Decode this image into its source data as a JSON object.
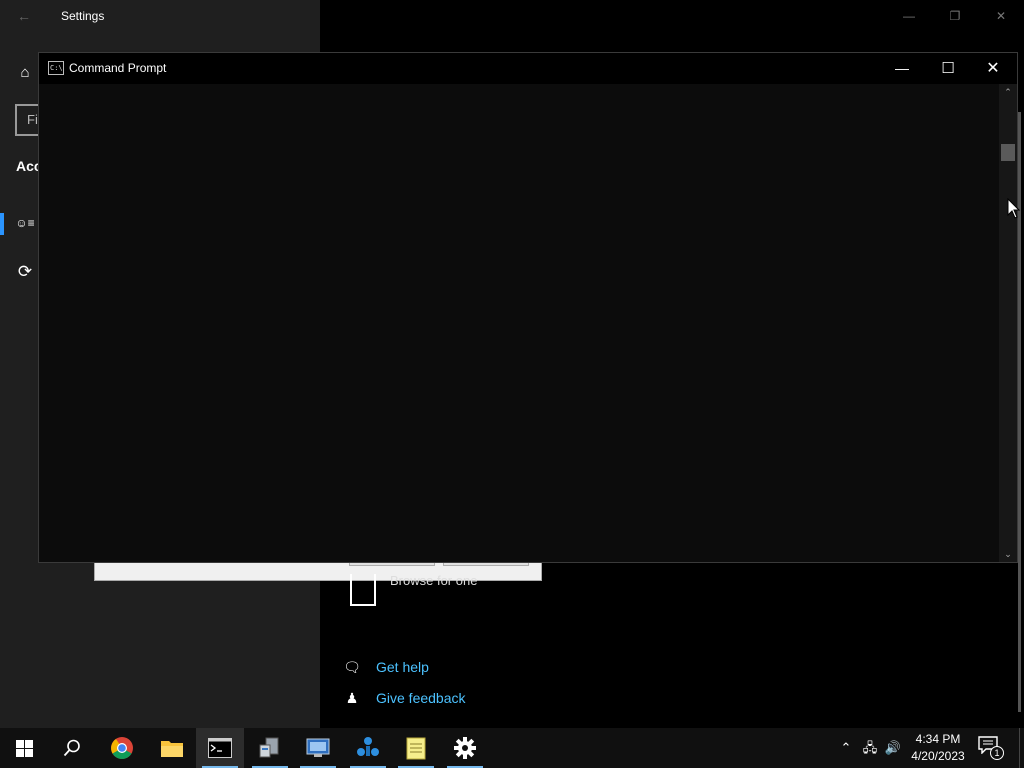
{
  "settings": {
    "title": "Settings",
    "search_placeholder": "Fi",
    "nav_heading": "Acc",
    "browse_text": "Browse for one",
    "help_links": [
      "Get help",
      "Give feedback"
    ]
  },
  "cmd": {
    "title": "Command Prompt",
    "icon_text": "C:\\",
    "console_text": ""
  },
  "taskbar": {
    "apps": [
      {
        "name": "start-button",
        "icon": "windows-logo-icon",
        "active": false
      },
      {
        "name": "search-button",
        "icon": "search-icon",
        "active": false
      },
      {
        "name": "chrome-taskbar-button",
        "icon": "chrome-icon",
        "active": false
      },
      {
        "name": "file-explorer-taskbar-button",
        "icon": "folder-icon",
        "active": false
      },
      {
        "name": "command-prompt-taskbar-button",
        "icon": "command-prompt-icon",
        "active": true
      },
      {
        "name": "app-taskbar-button-1",
        "icon": "server-manager-icon",
        "active": false
      },
      {
        "name": "app-taskbar-button-2",
        "icon": "remote-desktop-icon",
        "active": false
      },
      {
        "name": "app-taskbar-button-3",
        "icon": "network-icon",
        "active": false
      },
      {
        "name": "notepad-taskbar-button",
        "icon": "notepad-icon",
        "active": false
      },
      {
        "name": "settings-taskbar-button",
        "icon": "gear-icon",
        "active": false
      }
    ],
    "time": "4:34 PM",
    "date": "4/20/2023",
    "notification_count": "1"
  },
  "colors": {
    "accent": "#2b95ff",
    "link": "#4cc2ff",
    "console_bg": "#0c0c0c",
    "taskbar_bg": "#101010"
  }
}
